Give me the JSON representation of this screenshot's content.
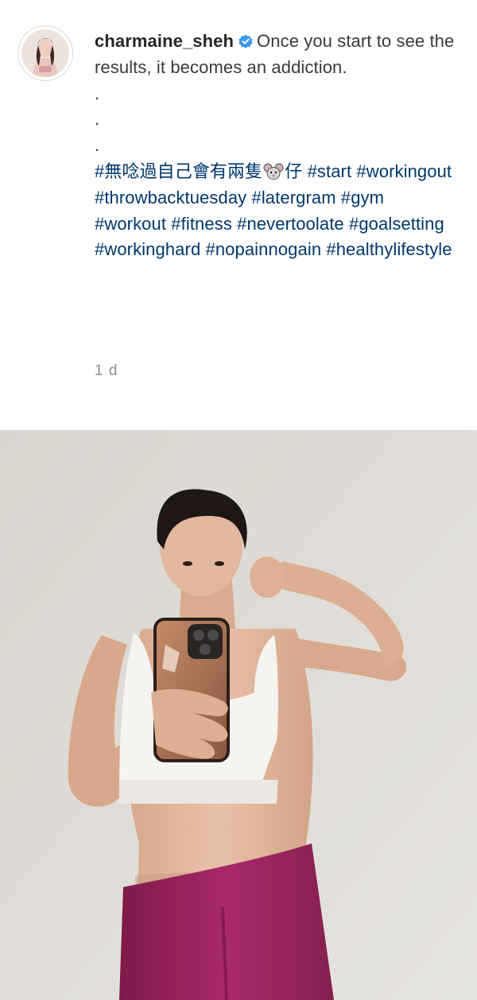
{
  "post": {
    "username": "charmaine_sheh",
    "verified_icon": "verified-badge-icon",
    "caption_text": "Once you start to see the results, it becomes an addiction.",
    "dots": [
      ".",
      ".",
      "."
    ],
    "hashtag_prefix": "#無唸過自己會有兩隻",
    "hashtag_emoji": "mouse-face-emoji",
    "hashtag_suffix": "仔",
    "hashtags": [
      "#start",
      "#workingout",
      "#throwbacktuesday",
      "#latergram",
      "#gym",
      "#workout",
      "#fitness",
      "#nevertoolate",
      "#goalsetting",
      "#workinghard",
      "#nopainnogain",
      "#healthylifestyle"
    ],
    "timestamp": "1 d"
  },
  "colors": {
    "hashtag": "#00376b",
    "verified": "#3897f0",
    "timestamp": "#8e8e8e",
    "leggings": "#a0245e",
    "wall": "#dcd9d5"
  }
}
